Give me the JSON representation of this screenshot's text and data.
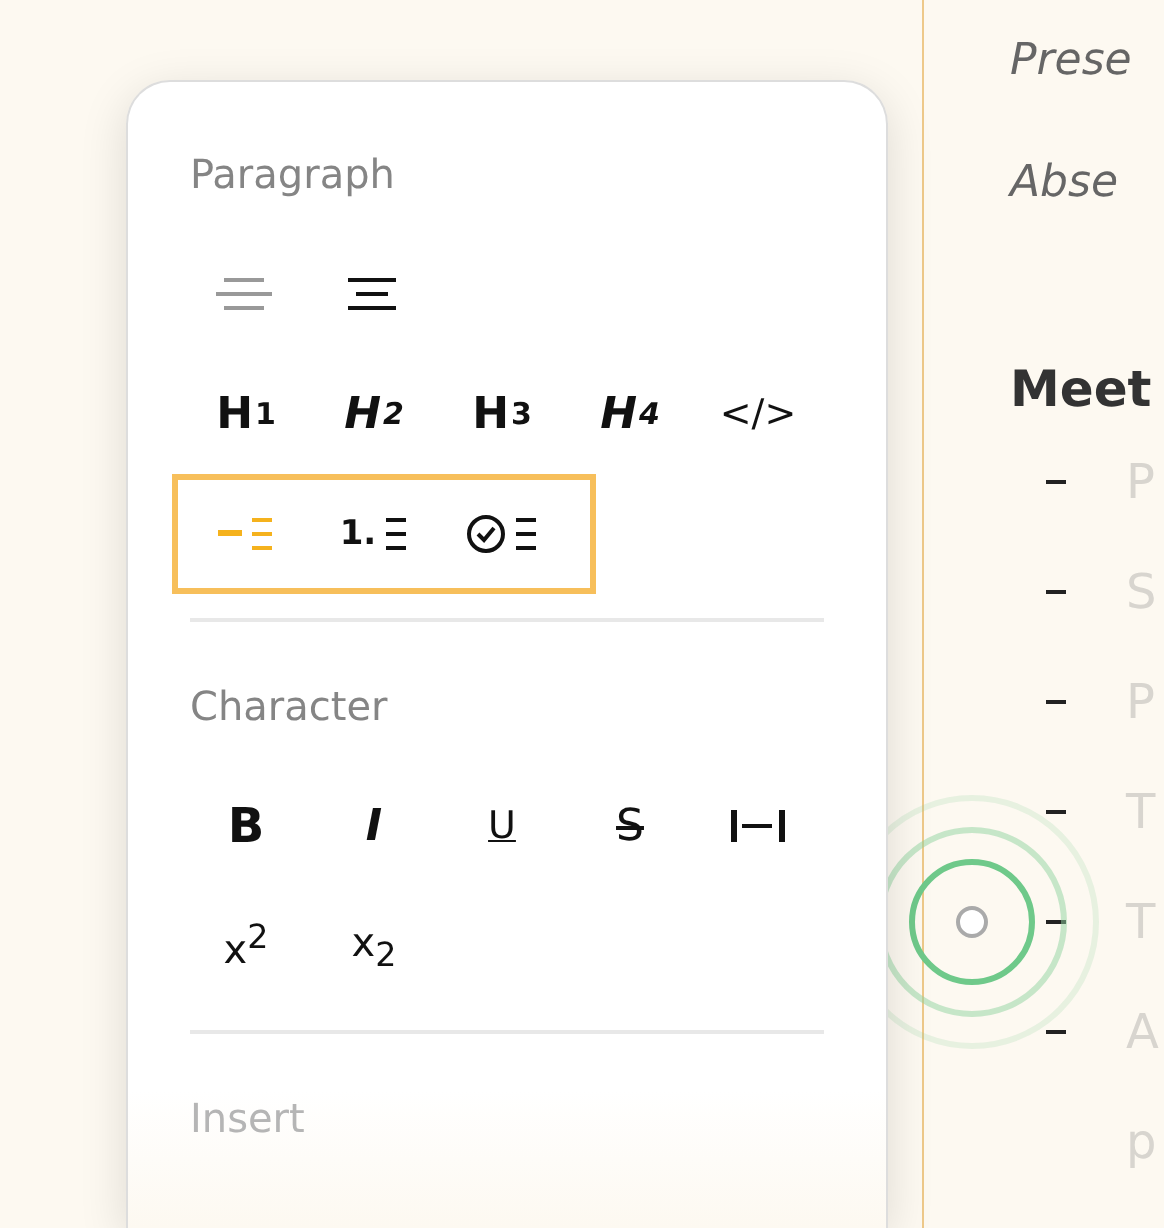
{
  "document": {
    "lines": [
      {
        "text": "Prese",
        "kind": "italic"
      },
      {
        "text": "Abse",
        "kind": "italic"
      },
      {
        "text": "Meet",
        "kind": "heading"
      }
    ],
    "items": [
      "P",
      "S",
      "P",
      "T",
      "T",
      "A"
    ],
    "trailing": "p"
  },
  "popover": {
    "sections": [
      {
        "title": "Paragraph",
        "rows": [
          {
            "kind": "align",
            "items": [
              {
                "kind": "left",
                "selected": false
              },
              {
                "kind": "center",
                "selected": true
              }
            ]
          },
          {
            "kind": "heading",
            "items": [
              {
                "kind": "heading",
                "letter": "H",
                "level": "1",
                "italic": false
              },
              {
                "kind": "heading",
                "letter": "H",
                "level": "2",
                "italic": true
              },
              {
                "kind": "heading",
                "letter": "H",
                "level": "3",
                "italic": false
              },
              {
                "kind": "heading",
                "letter": "H",
                "level": "4",
                "italic": true
              },
              {
                "kind": "code",
                "label": "</>"
              }
            ]
          },
          {
            "kind": "list",
            "highlighted": true,
            "items": [
              {
                "kind": "bullet",
                "selected": true
              },
              {
                "kind": "ordered",
                "label": "1.",
                "selected": false
              },
              {
                "kind": "task",
                "selected": false
              }
            ]
          }
        ]
      },
      {
        "title": "Character",
        "rows": [
          {
            "kind": "format",
            "items": [
              {
                "kind": "bold",
                "label": "B"
              },
              {
                "kind": "italic",
                "label": "I"
              },
              {
                "kind": "underline",
                "label": "U"
              },
              {
                "kind": "strike",
                "label": "S"
              },
              {
                "kind": "spacing"
              }
            ]
          },
          {
            "kind": "format",
            "items": [
              {
                "kind": "script",
                "label": "x$^{2}$"
              },
              {
                "kind": "script",
                "label": "x$_{2}$"
              }
            ]
          }
        ]
      },
      {
        "title": "Insert",
        "faded": true
      }
    ]
  }
}
